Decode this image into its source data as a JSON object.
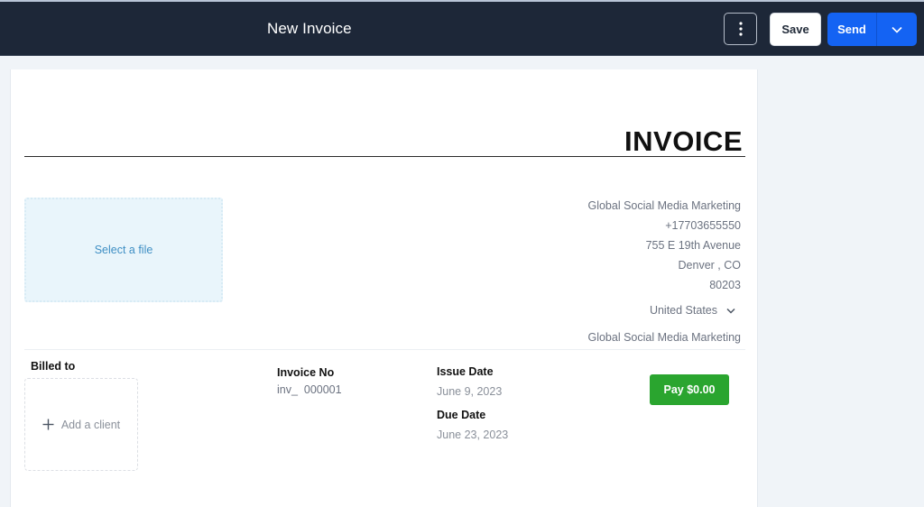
{
  "header": {
    "title": "New Invoice",
    "more_icon": "vertical-ellipsis-icon",
    "save_label": "Save",
    "send_label": "Send",
    "send_dropdown_icon": "chevron-down-icon"
  },
  "invoice": {
    "heading": "INVOICE",
    "logo_upload_label": "Select a file",
    "company": {
      "name": "Global Social Media Marketing",
      "phone": "+17703655550",
      "street": "755 E 19th Avenue",
      "city_state": "Denver , CO",
      "zip": "80203",
      "country": "United States",
      "footer_name": "Global Social Media Marketing"
    },
    "billed_to_label": "Billed to",
    "add_client_label": "Add a client",
    "invoice_no_label": "Invoice No",
    "invoice_no_value": "inv_  000001",
    "issue_date_label": "Issue Date",
    "issue_date_value": "June 9, 2023",
    "due_date_label": "Due Date",
    "due_date_value": "June 23, 2023",
    "pay_button_label": "Pay $0.00"
  },
  "colors": {
    "header_bg": "#1d2738",
    "primary": "#1463f3",
    "pay_green": "#2aa52f",
    "page_bg": "#f0f4f8"
  }
}
